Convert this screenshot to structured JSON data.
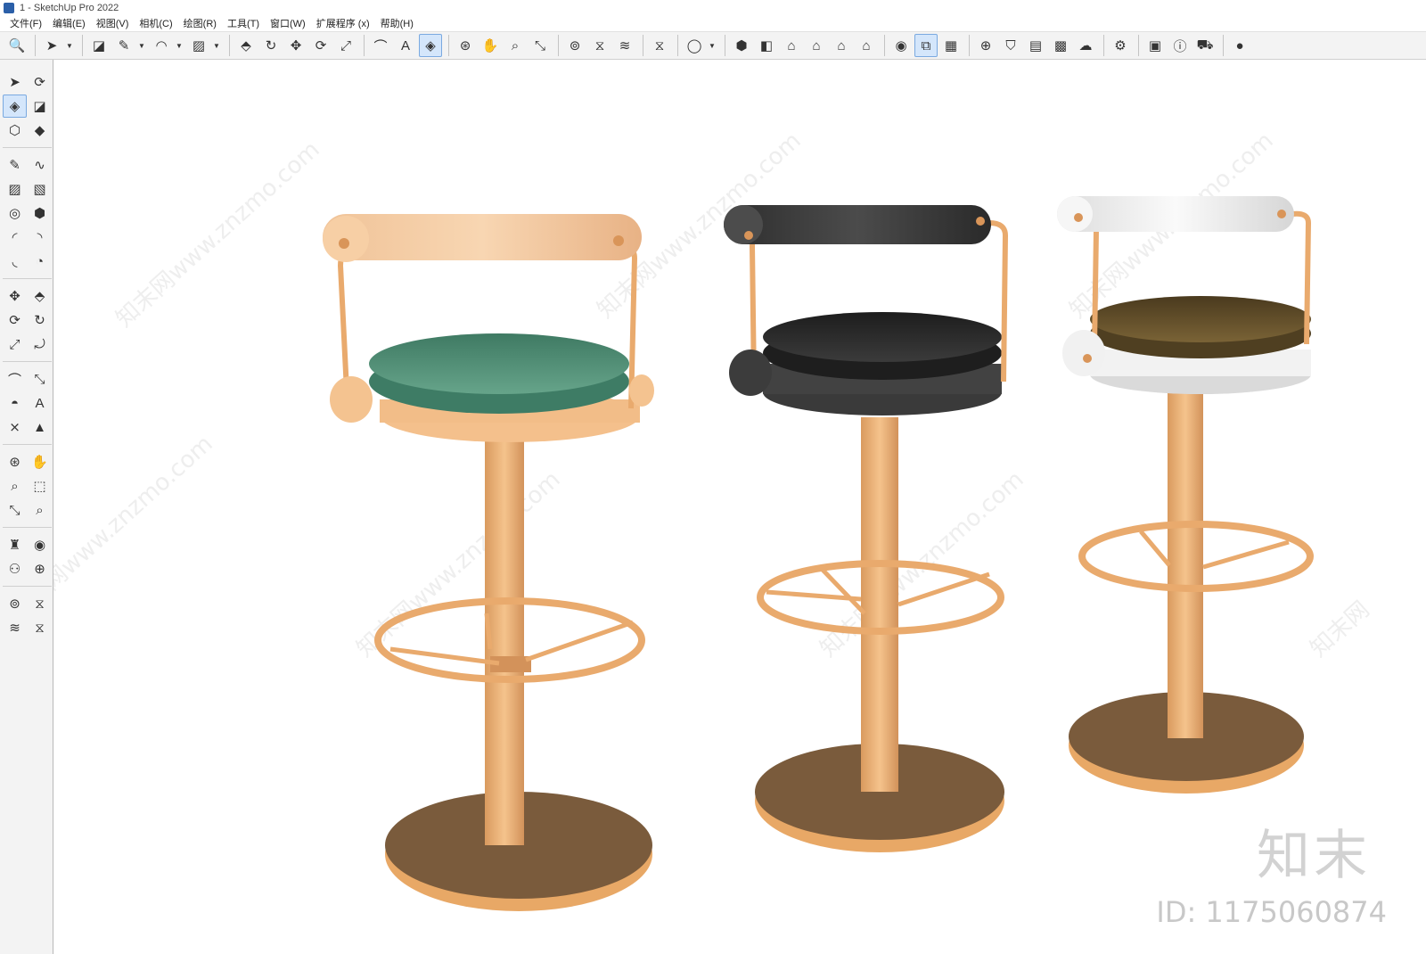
{
  "window": {
    "title": "1 - SketchUp Pro 2022"
  },
  "menu": [
    "文件(F)",
    "编辑(E)",
    "视图(V)",
    "相机(C)",
    "绘图(R)",
    "工具(T)",
    "窗口(W)",
    "扩展程序 (x)",
    "帮助(H)"
  ],
  "toolbar": {
    "icons": [
      {
        "name": "search-icon",
        "glyph": "🔍"
      },
      {
        "sep": true
      },
      {
        "name": "select-tool-icon",
        "glyph": "➤",
        "drop": true
      },
      {
        "sep": true
      },
      {
        "name": "eraser-tool-icon",
        "glyph": "◪"
      },
      {
        "name": "line-tool-icon",
        "glyph": "✎",
        "drop": true
      },
      {
        "name": "arc-tool-icon",
        "glyph": "◠",
        "drop": true
      },
      {
        "name": "rectangle-tool-icon",
        "glyph": "▨",
        "drop": true
      },
      {
        "sep": true
      },
      {
        "name": "push-pull-tool-icon",
        "glyph": "⬘"
      },
      {
        "name": "follow-me-tool-icon",
        "glyph": "↻"
      },
      {
        "name": "move-tool-icon",
        "glyph": "✥"
      },
      {
        "name": "rotate-tool-icon",
        "glyph": "⟳"
      },
      {
        "name": "scale-tool-icon",
        "glyph": "⤢"
      },
      {
        "sep": true
      },
      {
        "name": "tape-measure-tool-icon",
        "glyph": "⌒"
      },
      {
        "name": "text-tool-icon",
        "glyph": "A"
      },
      {
        "name": "paint-bucket-tool-icon",
        "glyph": "◈",
        "active": true
      },
      {
        "sep": true
      },
      {
        "name": "orbit-tool-icon",
        "glyph": "⊛"
      },
      {
        "name": "pan-tool-icon",
        "glyph": "✋"
      },
      {
        "name": "zoom-tool-icon",
        "glyph": "⌕"
      },
      {
        "name": "zoom-extents-icon",
        "glyph": "⤡"
      },
      {
        "sep": true
      },
      {
        "name": "warehouse-icon",
        "glyph": "⊚"
      },
      {
        "name": "extension-icon",
        "glyph": "⧖"
      },
      {
        "name": "layers-icon",
        "glyph": "≋"
      },
      {
        "sep": true
      },
      {
        "name": "components-icon",
        "glyph": "⧖"
      },
      {
        "sep": true
      },
      {
        "name": "user-account-icon",
        "glyph": "◯",
        "drop": true
      },
      {
        "sep": true
      },
      {
        "name": "iso-view-icon",
        "glyph": "⬢"
      },
      {
        "name": "top-view-icon",
        "glyph": "◧"
      },
      {
        "name": "front-view-icon",
        "glyph": "⌂"
      },
      {
        "name": "right-view-icon",
        "glyph": "⌂"
      },
      {
        "name": "back-view-icon",
        "glyph": "⌂"
      },
      {
        "name": "left-view-icon",
        "glyph": "⌂"
      },
      {
        "sep": true
      },
      {
        "name": "solid-tools-icon",
        "glyph": "◉"
      },
      {
        "name": "section-plane-icon",
        "glyph": "⧉",
        "active": true
      },
      {
        "name": "section-cut-icon",
        "glyph": "▦"
      },
      {
        "sep": true
      },
      {
        "name": "add-location-icon",
        "glyph": "⊕"
      },
      {
        "name": "shadows-icon",
        "glyph": "⛉"
      },
      {
        "name": "styles-icon",
        "glyph": "▤"
      },
      {
        "name": "materials-icon",
        "glyph": "▩"
      },
      {
        "name": "cloud-upload-icon",
        "glyph": "☁"
      },
      {
        "sep": true
      },
      {
        "name": "settings-icon",
        "glyph": "⚙"
      },
      {
        "sep": true
      },
      {
        "name": "dialog-icon",
        "glyph": "▣"
      },
      {
        "name": "info-icon",
        "glyph": "ⓘ"
      },
      {
        "name": "cart-icon",
        "glyph": "⛟"
      },
      {
        "sep": true
      },
      {
        "name": "profile-icon",
        "glyph": "●"
      }
    ]
  },
  "palette": {
    "icons": [
      {
        "name": "select-icon",
        "glyph": "➤"
      },
      {
        "name": "lasso-icon",
        "glyph": "⟳"
      },
      {
        "name": "paint-bucket-icon",
        "glyph": "◈",
        "active": true
      },
      {
        "name": "eraser-icon",
        "glyph": "◪"
      },
      {
        "name": "make-component-icon",
        "glyph": "⬡"
      },
      {
        "name": "tag-icon",
        "glyph": "◆"
      },
      {
        "sep": true
      },
      {
        "name": "line-icon",
        "glyph": "✎"
      },
      {
        "name": "freehand-icon",
        "glyph": "∿"
      },
      {
        "name": "rectangle-icon",
        "glyph": "▨"
      },
      {
        "name": "rotated-rectangle-icon",
        "glyph": "▧"
      },
      {
        "name": "circle-icon",
        "glyph": "◎"
      },
      {
        "name": "polygon-icon",
        "glyph": "⬢"
      },
      {
        "name": "arc-icon",
        "glyph": "◜"
      },
      {
        "name": "two-point-arc-icon",
        "glyph": "◝"
      },
      {
        "name": "three-point-arc-icon",
        "glyph": "◟"
      },
      {
        "name": "pie-icon",
        "glyph": "◔"
      },
      {
        "sep": true
      },
      {
        "name": "move-icon",
        "glyph": "✥"
      },
      {
        "name": "push-pull-icon",
        "glyph": "⬘"
      },
      {
        "name": "rotate-icon",
        "glyph": "⟳"
      },
      {
        "name": "follow-me-icon",
        "glyph": "↻"
      },
      {
        "name": "scale-icon",
        "glyph": "⤢"
      },
      {
        "name": "offset-icon",
        "glyph": "⤾"
      },
      {
        "sep": true
      },
      {
        "name": "tape-measure-icon",
        "glyph": "⌒"
      },
      {
        "name": "dimension-icon",
        "glyph": "⤡"
      },
      {
        "name": "protractor-icon",
        "glyph": "◓"
      },
      {
        "name": "text-icon",
        "glyph": "A"
      },
      {
        "name": "axes-icon",
        "glyph": "⨯"
      },
      {
        "name": "3d-text-icon",
        "glyph": "▲"
      },
      {
        "sep": true
      },
      {
        "name": "orbit-icon",
        "glyph": "⊛"
      },
      {
        "name": "pan-icon",
        "glyph": "✋"
      },
      {
        "name": "zoom-icon",
        "glyph": "⌕"
      },
      {
        "name": "zoom-window-icon",
        "glyph": "⬚"
      },
      {
        "name": "zoom-extents-icon",
        "glyph": "⤡"
      },
      {
        "name": "previous-view-icon",
        "glyph": "⌕"
      },
      {
        "sep": true
      },
      {
        "name": "position-camera-icon",
        "glyph": "♜"
      },
      {
        "name": "look-around-icon",
        "glyph": "◉"
      },
      {
        "name": "walk-icon",
        "glyph": "⚇"
      },
      {
        "name": "section-plane-icon",
        "glyph": "⊕"
      },
      {
        "sep": true
      },
      {
        "name": "warehouse-icon",
        "glyph": "⊚"
      },
      {
        "name": "extension-warehouse-icon",
        "glyph": "⧖"
      },
      {
        "name": "layers-icon",
        "glyph": "≋"
      },
      {
        "name": "components-icon",
        "glyph": "⧖"
      }
    ]
  },
  "colors": {
    "frame": "#f0b77b",
    "frame_dark": "#c98a4e",
    "base_top": "#7a5b3c",
    "seat_green": "#4e8f78",
    "seat_black": "#2e2e2e",
    "seat_brown": "#5c4a28",
    "back_peach": "#f2c59a",
    "back_black": "#3a3a3a",
    "back_white": "#eeeeee"
  },
  "watermark": {
    "logo": "知末",
    "id": "ID: 1175060874"
  }
}
